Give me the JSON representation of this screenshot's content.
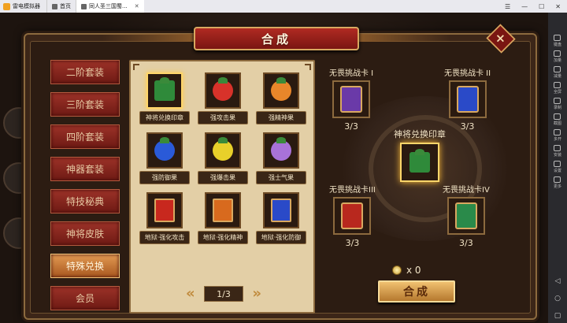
{
  "emulator": {
    "app_name": "雷电模拟器",
    "tabs": [
      {
        "label": "首页"
      },
      {
        "label": "同人圣三国蜀..."
      }
    ],
    "sidebar_items": [
      {
        "label": "键盘"
      },
      {
        "label": "加量"
      },
      {
        "label": "减量"
      },
      {
        "label": "全屏"
      },
      {
        "label": "录制"
      },
      {
        "label": "截图"
      },
      {
        "label": "多开"
      },
      {
        "label": "安装"
      },
      {
        "label": "设置"
      },
      {
        "label": "更多"
      }
    ]
  },
  "dialog": {
    "title": "合成",
    "close_icon": "×"
  },
  "tabs": [
    {
      "label": "二阶套装",
      "active": false
    },
    {
      "label": "三阶套装",
      "active": false
    },
    {
      "label": "四阶套装",
      "active": false
    },
    {
      "label": "神器套装",
      "active": false
    },
    {
      "label": "特技秘典",
      "active": false
    },
    {
      "label": "神将皮肤",
      "active": false
    },
    {
      "label": "特殊兑换",
      "active": true
    },
    {
      "label": "会员",
      "active": false
    }
  ],
  "items": [
    {
      "label": "神将兑换印章",
      "selected": true,
      "kind": "seal",
      "color": "#2f8a3a"
    },
    {
      "label": "强攻击果",
      "selected": false,
      "kind": "fruit",
      "color": "#d8322a"
    },
    {
      "label": "强精神果",
      "selected": false,
      "kind": "fruit",
      "color": "#e8862a"
    },
    {
      "label": "强防御果",
      "selected": false,
      "kind": "fruit",
      "color": "#2a5ad8"
    },
    {
      "label": "强爆击果",
      "selected": false,
      "kind": "fruit",
      "color": "#e8d02a"
    },
    {
      "label": "强士气果",
      "selected": false,
      "kind": "fruit",
      "color": "#a872d8"
    },
    {
      "label": "地狱·强化攻击",
      "selected": false,
      "kind": "book",
      "color": "#c8281e"
    },
    {
      "label": "地狱·强化精神",
      "selected": false,
      "kind": "book",
      "color": "#d86a1e"
    },
    {
      "label": "地狱·强化防御",
      "selected": false,
      "kind": "book",
      "color": "#2a4ac8"
    }
  ],
  "pager": {
    "current": "1/3",
    "prev_icon": "«",
    "next_icon": "»"
  },
  "synthesis": {
    "materials": [
      {
        "title": "无畏挑战卡 I",
        "count": "3/3",
        "color": "#6a3aa8"
      },
      {
        "title": "无畏挑战卡 II",
        "count": "3/3",
        "color": "#2a4ac8"
      },
      {
        "title": "无畏挑战卡III",
        "count": "3/3",
        "color": "#b8281e"
      },
      {
        "title": "无畏挑战卡IV",
        "count": "3/3",
        "color": "#2a8a4a"
      }
    ],
    "result": {
      "title": "神将兑换印章",
      "color": "#2f8a3a"
    },
    "cost": "x 0",
    "button": "合成"
  }
}
